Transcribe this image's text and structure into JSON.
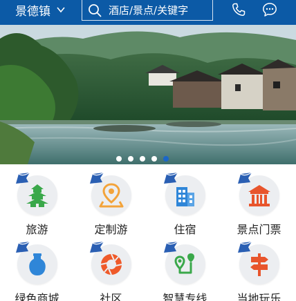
{
  "header": {
    "city": "景德镇",
    "search_placeholder": "酒店/景点/关键字",
    "icons": [
      "chevron-down-icon",
      "search-icon",
      "phone-icon",
      "chat-icon"
    ]
  },
  "banner": {
    "slide_count": 5,
    "active_index": 4
  },
  "grid": {
    "items": [
      {
        "label": "旅游",
        "icon": "pagoda-icon",
        "color": "#3aa84a"
      },
      {
        "label": "定制游",
        "icon": "map-pin-icon",
        "color": "#f3a33a"
      },
      {
        "label": "住宿",
        "icon": "building-icon",
        "color": "#2f86d8"
      },
      {
        "label": "景点门票",
        "icon": "temple-icon",
        "color": "#e8552c"
      },
      {
        "label": "绿色商城",
        "icon": "vase-icon",
        "color": "#2f86d8"
      },
      {
        "label": "社区",
        "icon": "aperture-icon",
        "color": "#ef5a2a"
      },
      {
        "label": "智慧专线",
        "icon": "route-icon",
        "color": "#3aa84a"
      },
      {
        "label": "当地玩乐",
        "icon": "signpost-icon",
        "color": "#e8552c"
      }
    ]
  },
  "colors": {
    "topbar": "#0c5aa6",
    "active_dot": "#1a66c9"
  }
}
